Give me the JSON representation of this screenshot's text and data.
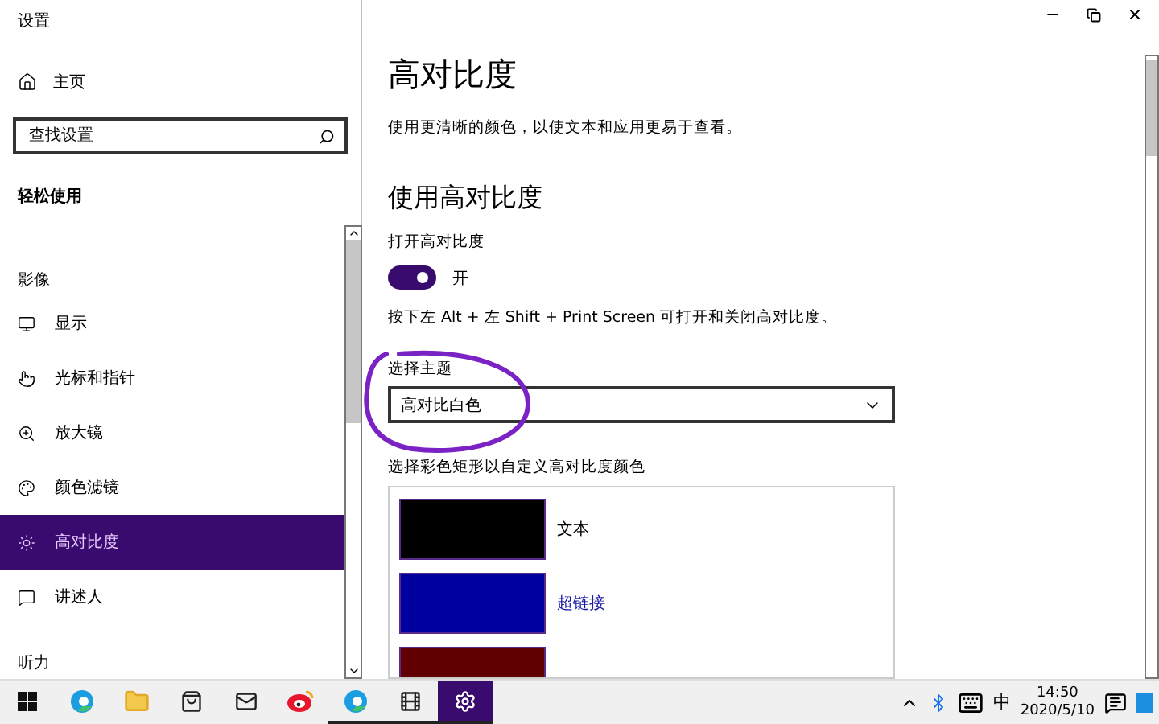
{
  "window": {
    "title": "设置"
  },
  "sidebar": {
    "home": "主页",
    "search": {
      "placeholder": "查找设置"
    },
    "section": "轻松使用",
    "category": "影像",
    "items": [
      {
        "label": "显示",
        "selected": false
      },
      {
        "label": "光标和指针",
        "selected": false
      },
      {
        "label": "放大镜",
        "selected": false
      },
      {
        "label": "颜色滤镜",
        "selected": false
      },
      {
        "label": "高对比度",
        "selected": true
      },
      {
        "label": "讲述人",
        "selected": false
      }
    ],
    "next_category": "听力"
  },
  "main": {
    "title": "高对比度",
    "description": "使用更清晰的颜色，以使文本和应用更易于查看。",
    "section": "使用高对比度",
    "toggle": {
      "label": "打开高对比度",
      "on": true,
      "state_text": "开"
    },
    "shortcut": "按下左 Alt + 左 Shift + Print Screen 可打开和关闭高对比度。",
    "theme": {
      "label": "选择主题",
      "value": "高对比白色"
    },
    "swatches_label": "选择彩色矩形以自定义高对比度颜色",
    "swatches": [
      {
        "label": "文本",
        "color": "#000000",
        "kind": "text"
      },
      {
        "label": "超链接",
        "color": "#00009f",
        "kind": "link"
      },
      {
        "color": "#600000",
        "kind": "text"
      }
    ]
  },
  "taskbar": {
    "apps": [
      {
        "running": false,
        "selected": false
      },
      {
        "running": false,
        "selected": false
      },
      {
        "running": false,
        "selected": false
      },
      {
        "running": false,
        "selected": false
      },
      {
        "running": false,
        "selected": false
      },
      {
        "running": true,
        "selected": false
      },
      {
        "running": true,
        "selected": false
      },
      {
        "running": true,
        "selected": true
      }
    ],
    "ime": "中",
    "time": "14:50",
    "date": "2020/5/10"
  }
}
